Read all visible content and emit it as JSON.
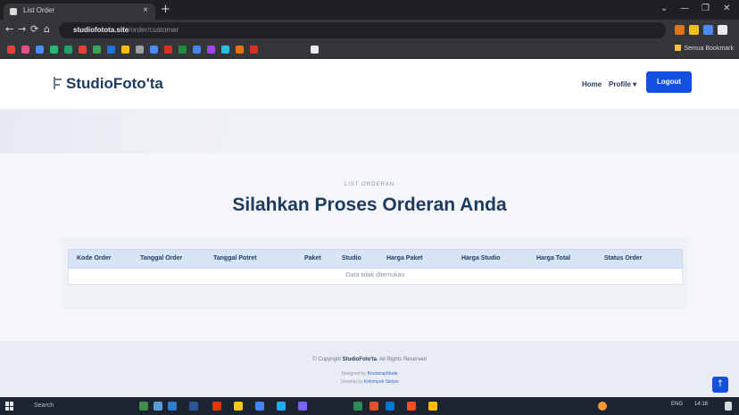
{
  "browser": {
    "tab_title": "List Order",
    "tab_close": "×",
    "new_tab": "+",
    "window_controls": [
      "⌄",
      "—",
      "❐",
      "✕"
    ],
    "nav": {
      "back": "←",
      "forward": "→",
      "reload": "⟳",
      "home": "⌂"
    },
    "url_host": "studiofotota.site",
    "url_path": "/order/customer",
    "bookmarks_all_label": "Semua Bookmark",
    "colors": {
      "tabbar": "#1f2023",
      "toolbar": "#35363a",
      "omnibox": "#202124"
    }
  },
  "header": {
    "logo_text": "StudioFoto'ta",
    "nav": {
      "home": "Home",
      "profile": "Profile ▾"
    },
    "logout_label": "Logout",
    "accent_color": "#1451e0"
  },
  "main": {
    "eyebrow": "LIST ORDERAN",
    "title": "Silahkan Proses Orderan Anda",
    "table": {
      "columns": [
        "Kode Order",
        "Tanggal Order",
        "Tanggal Potret",
        "Paket",
        "Studio",
        "Harga Paket",
        "Harga Studio",
        "Harga Total",
        "Status Order"
      ],
      "empty_message": "Data tidak ditemukan",
      "rows": []
    }
  },
  "footer": {
    "copyright_prefix": "© Copyright",
    "brand": "StudioFoto'ta",
    "copyright_suffix": "All Rights Reserved",
    "designed_by_prefix": "Designed by",
    "designed_by": "BootstrapMade",
    "distributed_by_prefix": "Develop by",
    "distributed_by": "Kelompok Skripsi"
  },
  "back_to_top": "↑",
  "taskbar": {
    "search_placeholder": "Search",
    "tray_time": "14:16",
    "tray_lang": "ENG"
  }
}
